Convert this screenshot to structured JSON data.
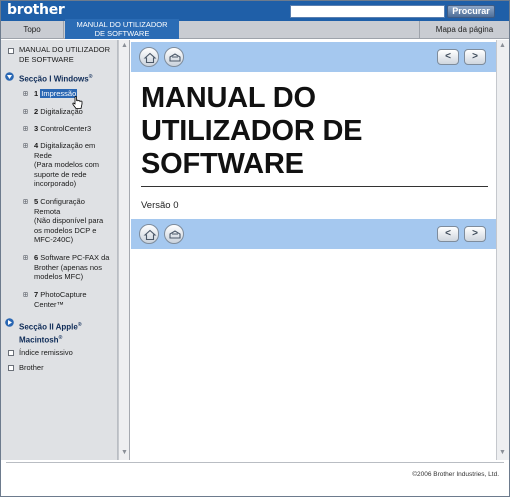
{
  "header": {
    "logo": "brother",
    "search_button": "Procurar",
    "search_value": ""
  },
  "tabs": {
    "top": "Topo",
    "manual_line1": "MANUAL DO UTILIZADOR",
    "manual_line2": "DE SOFTWARE",
    "sitemap": "Mapa da página"
  },
  "sidebar": {
    "manual_line1": "MANUAL DO UTILIZADOR",
    "manual_line2": "DE SOFTWARE",
    "section1": "Secção I Windows",
    "section1_sup": "®",
    "items": [
      {
        "num": "1",
        "label": "Impressão"
      },
      {
        "num": "2",
        "label": "Digitalização"
      },
      {
        "num": "3",
        "label": "ControlCenter3"
      },
      {
        "num": "4",
        "label": "Digitalização em",
        "more": [
          "Rede",
          "(Para modelos com",
          "suporte de rede",
          "incorporado)"
        ]
      },
      {
        "num": "5",
        "label": "Configuração",
        "more": [
          "Remota",
          "(Não disponível para",
          "os modelos DCP e",
          "MFC-240C)"
        ]
      },
      {
        "num": "6",
        "label": "Software PC-FAX da",
        "more": [
          "Brother (apenas nos",
          "modelos MFC)"
        ]
      },
      {
        "num": "7",
        "label": "PhotoCapture",
        "more": [
          "Center™"
        ]
      }
    ],
    "section2_line1": "Secção II Apple",
    "section2_sup1": "®",
    "section2_line2": "Macintosh",
    "section2_sup2": "®",
    "index": "Índice remissivo",
    "brother": "Brother"
  },
  "content": {
    "title_line1": "MANUAL DO",
    "title_line2": "UTILIZADOR DE",
    "title_line3": "SOFTWARE",
    "version": "Versão 0"
  },
  "footer": {
    "copyright": "©2006 Brother Industries, Ltd."
  },
  "colors": {
    "brand_blue": "#1f5fa8",
    "active_tab": "#2b6cb5",
    "nav_bar": "#a5c8ef",
    "sidebar_bg": "#dfe1e4"
  }
}
